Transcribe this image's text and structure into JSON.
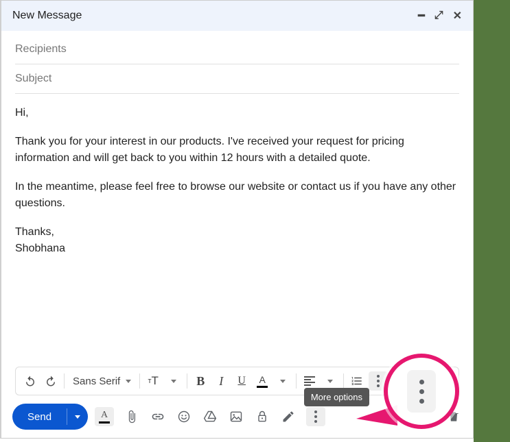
{
  "header": {
    "title": "New Message"
  },
  "fields": {
    "recipients_placeholder": "Recipients",
    "subject_placeholder": "Subject"
  },
  "body": {
    "greeting": "Hi,",
    "p1": "Thank you for your interest in our products. I've received your request for pricing information and will get back to you within 12 hours with a detailed quote.",
    "p2": "In the meantime, please feel free to browse our website or contact us if you have any other questions.",
    "signoff": "Thanks,",
    "signature": "Shobhana"
  },
  "format_toolbar": {
    "font": "Sans Serif",
    "bold": "B",
    "italic": "I",
    "underline": "U",
    "textcolor": "A"
  },
  "tooltip": {
    "more_options": "More options"
  },
  "bottom": {
    "send": "Send"
  }
}
